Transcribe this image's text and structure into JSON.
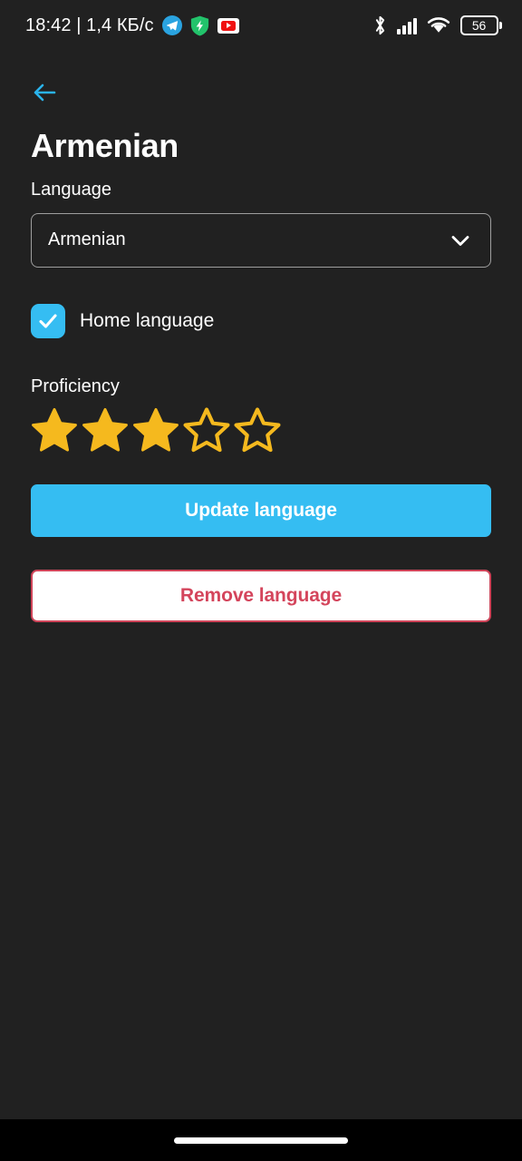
{
  "status_bar": {
    "clock": "18:42 | 1,4 КБ/с",
    "battery_level": "56",
    "icons": [
      "telegram-icon",
      "shield-icon",
      "youtube-icon",
      "bluetooth-icon",
      "cellular-signal-icon",
      "wifi-icon",
      "battery-icon"
    ]
  },
  "header": {
    "back_icon": "arrow-left-icon",
    "title": "Armenian"
  },
  "form": {
    "language_label": "Language",
    "language_value": "Armenian",
    "language_dropdown_icon": "chevron-down-icon",
    "home_language_label": "Home language",
    "home_language_checked": true,
    "proficiency_label": "Proficiency",
    "proficiency_rating": 3,
    "proficiency_max": 5
  },
  "actions": {
    "update_label": "Update language",
    "remove_label": "Remove language"
  },
  "colors": {
    "background": "#212121",
    "accent_blue": "#35bdf2",
    "danger_red": "#cf4459",
    "star_gold": "#f5b91e",
    "text_primary": "#ffffff",
    "nav_bar": "#000000"
  }
}
